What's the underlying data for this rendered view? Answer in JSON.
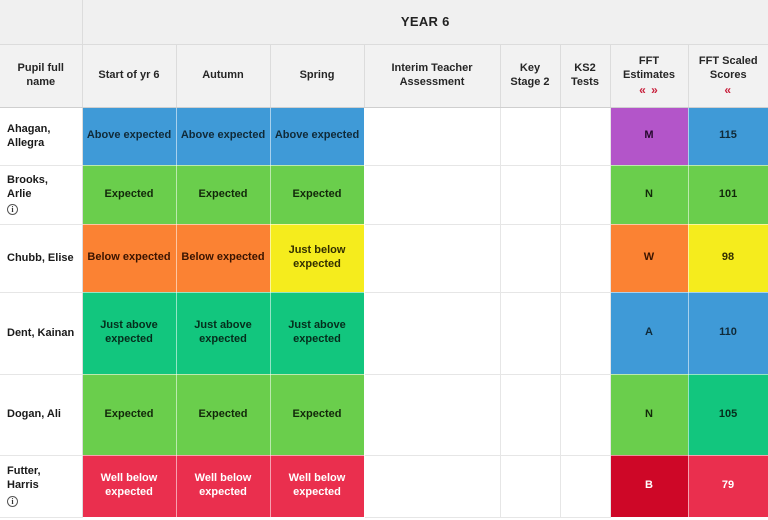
{
  "title_band": {
    "title": "YEAR 6"
  },
  "columns": [
    {
      "id": "pupil-full-name",
      "label": "Pupil full name",
      "chevrons": ""
    },
    {
      "id": "start-of-yr-6",
      "label": "Start of yr 6",
      "chevrons": ""
    },
    {
      "id": "autumn",
      "label": "Autumn",
      "chevrons": ""
    },
    {
      "id": "spring",
      "label": "Spring",
      "chevrons": ""
    },
    {
      "id": "interim-teacher-assessment",
      "label": "Interim Teacher Assessment",
      "chevrons": ""
    },
    {
      "id": "key-stage-2",
      "label": "Key Stage 2",
      "chevrons": ""
    },
    {
      "id": "ks2-tests",
      "label": "KS2 Tests",
      "chevrons": ""
    },
    {
      "id": "fft-estimates",
      "label": "FFT Estimates",
      "chevrons": "« »"
    },
    {
      "id": "fft-scaled-scores",
      "label": "FFT Scaled Scores",
      "chevrons": "«"
    }
  ],
  "icons": {
    "info": "i",
    "chevron_left_double": "«",
    "chevron_right_double": "»"
  },
  "palette": {
    "above_expected": {
      "bg": "#3f9ad7",
      "fg": "#102a38"
    },
    "expected": {
      "bg": "#6ace4c",
      "fg": "#12280a"
    },
    "below_expected": {
      "bg": "#fb8233",
      "fg": "#3a1400"
    },
    "just_below_expected": {
      "bg": "#f5ec1d",
      "fg": "#332f00"
    },
    "just_above_expected": {
      "bg": "#12c67e",
      "fg": "#052d1c"
    },
    "well_below_expected": {
      "bg": "#ea2f4e",
      "fg": "#ffffff"
    },
    "fft_m": {
      "bg": "#b355c9",
      "fg": "#26092d"
    },
    "fft_n": {
      "bg": "#6ace4c",
      "fg": "#12280a"
    },
    "fft_w": {
      "bg": "#fb8233",
      "fg": "#3a1400"
    },
    "fft_a": {
      "bg": "#3f9ad7",
      "fg": "#102a38"
    },
    "fft_b": {
      "bg": "#ce0727",
      "fg": "#ffffff"
    },
    "score_115": {
      "bg": "#3f9ad7",
      "fg": "#102a38"
    },
    "score_101": {
      "bg": "#6ace4c",
      "fg": "#12280a"
    },
    "score_98": {
      "bg": "#f5ec1d",
      "fg": "#332f00"
    },
    "score_110": {
      "bg": "#3f9ad7",
      "fg": "#102a38"
    },
    "score_105": {
      "bg": "#12c67e",
      "fg": "#052d1c"
    },
    "score_79": {
      "bg": "#ea2f4e",
      "fg": "#ffffff"
    },
    "empty": {
      "bg": "#ffffff",
      "fg": "#1a1a1a"
    },
    "header_bg": "#f2f2f2",
    "band_bg": "#f0f0f0",
    "chevron_red": "#c8203c",
    "grid_line": "#dcdcdc"
  },
  "rows": [
    {
      "name": "Ahagan, Allegra",
      "name_line1": "Ahagan,",
      "name_line2": "Allegra",
      "has_info_icon": false,
      "cells": [
        {
          "text": "Above expected",
          "style": "above_expected"
        },
        {
          "text": "Above expected",
          "style": "above_expected"
        },
        {
          "text": "Above expected",
          "style": "above_expected"
        },
        {
          "text": "",
          "style": "empty"
        },
        {
          "text": "",
          "style": "empty"
        },
        {
          "text": "",
          "style": "empty"
        },
        {
          "text": "M",
          "style": "fft_m"
        },
        {
          "text": "115",
          "style": "score_115"
        }
      ]
    },
    {
      "name": "Brooks, Arlie",
      "name_line1": "Brooks, Arlie",
      "name_line2": "",
      "has_info_icon": true,
      "cells": [
        {
          "text": "Expected",
          "style": "expected"
        },
        {
          "text": "Expected",
          "style": "expected"
        },
        {
          "text": "Expected",
          "style": "expected"
        },
        {
          "text": "",
          "style": "empty"
        },
        {
          "text": "",
          "style": "empty"
        },
        {
          "text": "",
          "style": "empty"
        },
        {
          "text": "N",
          "style": "fft_n"
        },
        {
          "text": "101",
          "style": "score_101"
        }
      ]
    },
    {
      "name": "Chubb, Elise",
      "name_line1": "Chubb, Elise",
      "name_line2": "",
      "has_info_icon": false,
      "cells": [
        {
          "text": "Below expected",
          "style": "below_expected"
        },
        {
          "text": "Below expected",
          "style": "below_expected"
        },
        {
          "text": "Just below expected",
          "style": "just_below_expected"
        },
        {
          "text": "",
          "style": "empty"
        },
        {
          "text": "",
          "style": "empty"
        },
        {
          "text": "",
          "style": "empty"
        },
        {
          "text": "W",
          "style": "fft_w"
        },
        {
          "text": "98",
          "style": "score_98"
        }
      ]
    },
    {
      "name": "Dent, Kainan",
      "name_line1": "Dent, Kainan",
      "name_line2": "",
      "has_info_icon": false,
      "cells": [
        {
          "text": "Just above expected",
          "style": "just_above_expected"
        },
        {
          "text": "Just above expected",
          "style": "just_above_expected"
        },
        {
          "text": "Just above expected",
          "style": "just_above_expected"
        },
        {
          "text": "",
          "style": "empty"
        },
        {
          "text": "",
          "style": "empty"
        },
        {
          "text": "",
          "style": "empty"
        },
        {
          "text": "A",
          "style": "fft_a"
        },
        {
          "text": "110",
          "style": "score_110"
        }
      ]
    },
    {
      "name": "Dogan, Ali",
      "name_line1": "Dogan, Ali",
      "name_line2": "",
      "has_info_icon": false,
      "cells": [
        {
          "text": "Expected",
          "style": "expected"
        },
        {
          "text": "Expected",
          "style": "expected"
        },
        {
          "text": "Expected",
          "style": "expected"
        },
        {
          "text": "",
          "style": "empty"
        },
        {
          "text": "",
          "style": "empty"
        },
        {
          "text": "",
          "style": "empty"
        },
        {
          "text": "N",
          "style": "fft_n"
        },
        {
          "text": "105",
          "style": "score_105"
        }
      ]
    },
    {
      "name": "Futter, Harris",
      "name_line1": "Futter, Harris",
      "name_line2": "",
      "has_info_icon": true,
      "cells": [
        {
          "text": "Well below expected",
          "style": "well_below_expected"
        },
        {
          "text": "Well below expected",
          "style": "well_below_expected"
        },
        {
          "text": "Well below expected",
          "style": "well_below_expected"
        },
        {
          "text": "",
          "style": "empty"
        },
        {
          "text": "",
          "style": "empty"
        },
        {
          "text": "",
          "style": "empty"
        },
        {
          "text": "B",
          "style": "fft_b"
        },
        {
          "text": "79",
          "style": "score_79"
        }
      ]
    }
  ]
}
